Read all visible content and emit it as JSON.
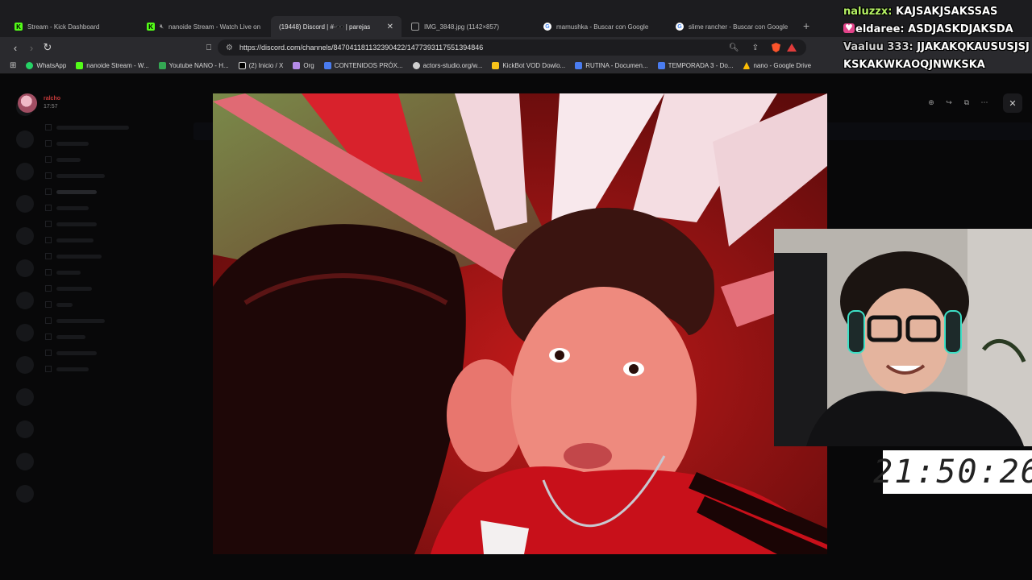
{
  "browser": {
    "tabs": [
      {
        "title": "Stream - Kick Dashboard",
        "favicon": "kick-icon",
        "active": false
      },
      {
        "title": "nanoide Stream - Watch Live on",
        "favicon": "kick-icon",
        "active": false
      },
      {
        "title": "(19448) Discord | #·🕶️ | parejas",
        "favicon": "discord-icon",
        "active": true
      },
      {
        "title": "IMG_3848.jpg (1142×857)",
        "favicon": "image-icon",
        "active": false
      },
      {
        "title": "mamushka - Buscar con Google",
        "favicon": "google-icon",
        "active": false
      },
      {
        "title": "slime rancher - Buscar con Google",
        "favicon": "google-icon",
        "active": false
      }
    ],
    "url": "https://discord.com/channels/847041181132390422/1477393117551394846",
    "bookmarks": [
      {
        "label": "WhatsApp",
        "color": "#25d366"
      },
      {
        "label": "nanoide Stream - W...",
        "color": "#53fc18"
      },
      {
        "label": "Youtube NANO - H...",
        "color": "#34a853"
      },
      {
        "label": "(2) Inicio / X",
        "color": "#ffffff"
      },
      {
        "label": "Org",
        "color": "#b48be8"
      },
      {
        "label": "CONTENIDOS PRÓX...",
        "color": "#4a7cf0"
      },
      {
        "label": "actors-studio.org/w...",
        "color": "#cfcfcf"
      },
      {
        "label": "KickBot VOD Dowlo...",
        "color": "#f7c21a"
      },
      {
        "label": "RUTINA - Documen...",
        "color": "#4a7cf0"
      },
      {
        "label": "TEMPORADA 3 - Do...",
        "color": "#4a7cf0"
      },
      {
        "label": "nano - Google Drive",
        "color": "#fbbc04"
      }
    ]
  },
  "viewer": {
    "username": "ralcho",
    "time": "17:57"
  },
  "chat_overlay": [
    {
      "user": "naluzzx:",
      "message": "KAJSAKJSAKSSAS",
      "badge": false
    },
    {
      "user": "eldaree:",
      "message": "ASDJASKDJAKSDA",
      "badge": true
    },
    {
      "user": "Vaaluu 333:",
      "message": "JJAKAKQKAUSUSJSJKSKAKWKAOQJNWKSKA",
      "badge": false
    }
  ],
  "timer": "21:50:26",
  "colors": {
    "kick_green": "#53fc18",
    "discord_blurple": "#5865f2",
    "chat_user_green": "#b4f064",
    "badge_pink": "#e3448a"
  }
}
